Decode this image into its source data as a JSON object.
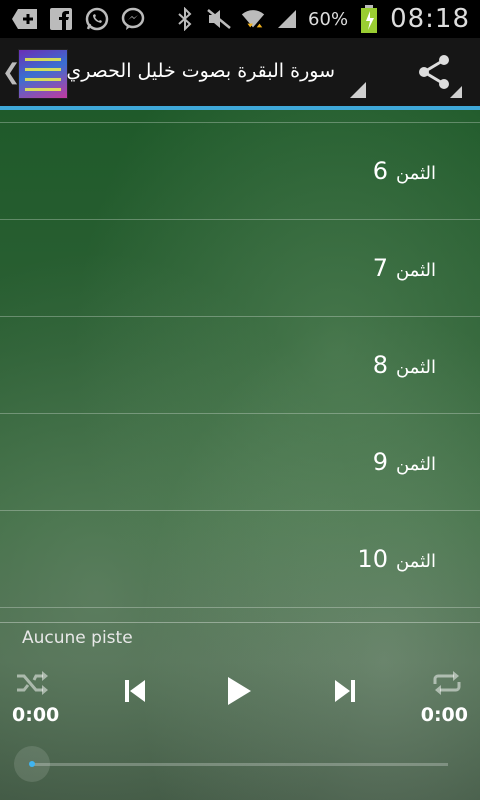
{
  "status_bar": {
    "battery_percent": "60%",
    "time": "08:18",
    "icons": [
      "add-icon",
      "facebook-icon",
      "whatsapp-icon",
      "messenger-icon",
      "bluetooth-icon",
      "mute-icon",
      "wifi-icon",
      "signal-icon",
      "battery-icon"
    ]
  },
  "action_bar": {
    "title": "سورة البقرة بصوت خليل الحصري",
    "accent_color": "#3fa8d8"
  },
  "list": {
    "items": [
      {
        "word": "الثمن",
        "number": "6"
      },
      {
        "word": "الثمن",
        "number": "7"
      },
      {
        "word": "الثمن",
        "number": "8"
      },
      {
        "word": "الثمن",
        "number": "9"
      },
      {
        "word": "الثمن",
        "number": "10"
      }
    ]
  },
  "player": {
    "track": "Aucune piste",
    "elapsed": "0:00",
    "duration": "0:00",
    "progress": 0
  }
}
